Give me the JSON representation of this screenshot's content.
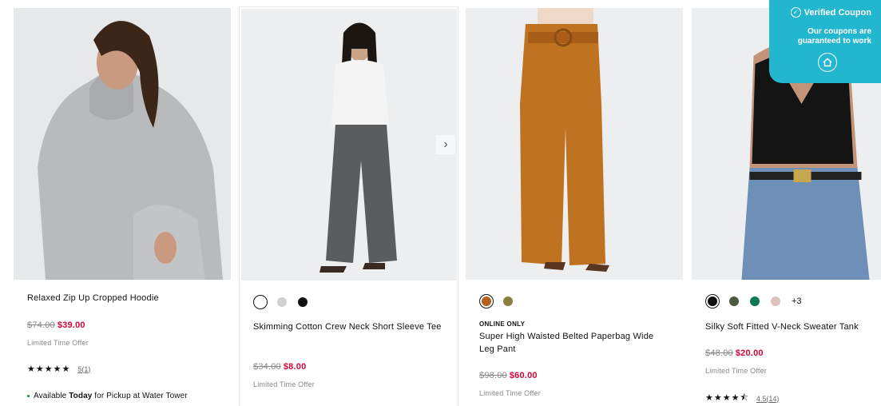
{
  "coupon": {
    "title": "Verified Coupon",
    "text": "Our coupons are guaranteed to work"
  },
  "products": [
    {
      "title": "Relaxed Zip Up Cropped Hoodie",
      "orig_price": "$74.00",
      "sale_price": "$39.00",
      "offer": "Limited Time Offer",
      "rating_count": "5(1)",
      "pickup_prefix": "Available ",
      "pickup_bold": "Today",
      "pickup_suffix": " for Pickup at Water Tower",
      "image_desc": "model in grey hoodie"
    },
    {
      "swatches": [
        "#ffffff",
        "#d0d0d0",
        "#111111"
      ],
      "title": "Skimming Cotton Crew Neck Short Sleeve Tee",
      "orig_price": "$34.00",
      "sale_price": "$8.00",
      "offer": "Limited Time Offer",
      "next_icon": "chevron-right-icon"
    },
    {
      "swatches": [
        "#b5611c",
        "#8c7d40"
      ],
      "badge": "ONLINE ONLY",
      "title": "Super High Waisted Belted Paperbag Wide Leg Pant",
      "orig_price": "$98.00",
      "sale_price": "$60.00",
      "offer": "Limited Time Offer"
    },
    {
      "swatches": [
        "#111111",
        "#4d5a3e",
        "#0a7a55",
        "#e0c2bc"
      ],
      "more_colors": "+3",
      "title": "Silky Soft Fitted V-Neck Sweater Tank",
      "orig_price": "$48.00",
      "sale_price": "$20.00",
      "offer": "Limited Time Offer",
      "rating_count": "4.5(14)"
    }
  ]
}
